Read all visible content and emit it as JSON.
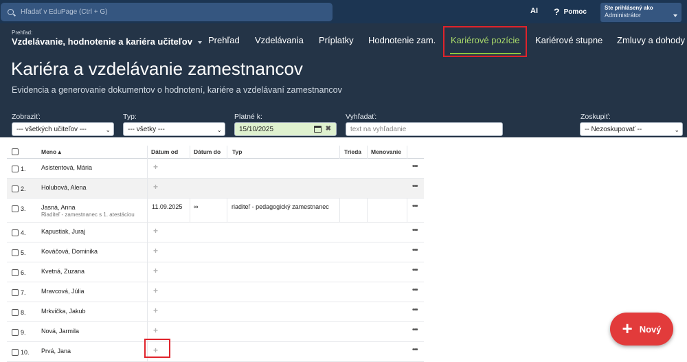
{
  "topbar": {
    "search_placeholder": "Hľadať v EduPage (Ctrl + G)",
    "ai_label": "AI",
    "help_label": "Pomoc",
    "user_label": "Ste prihlásený ako",
    "user_value": "Administrátor"
  },
  "header": {
    "breadcrumb_small": "Prehľad:",
    "breadcrumb_main": "Vzdelávanie, hodnotenie a kariéra učiteľov",
    "nav": [
      "Prehľad",
      "Vzdelávania",
      "Príplatky",
      "Hodnotenie zam.",
      "Kariérové pozície",
      "Kariérové stupne",
      "Zmluvy a dohody"
    ],
    "active_nav": "Kariérové pozície",
    "title": "Kariéra a vzdelávanie zamestnancov",
    "subtitle": "Evidencia a generovanie dokumentov o hodnotení, kariére a vzdelávaní zamestnancov"
  },
  "filters": {
    "show_label": "Zobraziť:",
    "show_value": "--- všetkých učiteľov ---",
    "type_label": "Typ:",
    "type_value": "--- všetky ---",
    "valid_label": "Platné k:",
    "valid_value": "15/10/2025",
    "search_label": "Vyhľadať:",
    "search_placeholder": "text na vyhľadanie",
    "group_label": "Zoskupiť:",
    "group_value": "-- Nezoskupovať --"
  },
  "table": {
    "columns": [
      "Meno",
      "Dátum od",
      "Dátum do",
      "Typ",
      "Trieda",
      "Menovanie"
    ],
    "rows": [
      {
        "num": "1.",
        "name": "Asistentová, Mária"
      },
      {
        "num": "2.",
        "name": "Holubová, Alena"
      },
      {
        "num": "3.",
        "name": "Jasná, Anna",
        "role": "Riaditeľ - zamestnanec s 1. atestáciou",
        "date_from": "11.09.2025",
        "date_to": "∞",
        "type": "riaditeľ - pedagogický zamestnanec"
      },
      {
        "num": "4.",
        "name": "Kapustiak, Juraj"
      },
      {
        "num": "5.",
        "name": "Kováčová, Dominika"
      },
      {
        "num": "6.",
        "name": "Kvetná, Zuzana"
      },
      {
        "num": "7.",
        "name": "Mravcová, Júlia"
      },
      {
        "num": "8.",
        "name": "Mrkvička, Jakub"
      },
      {
        "num": "9.",
        "name": "Nová, Jarmila"
      },
      {
        "num": "10.",
        "name": "Prvá, Jana"
      }
    ]
  },
  "fab": {
    "label": "Nový"
  },
  "colors": {
    "topbar": "#1c3552",
    "header": "#243447",
    "accent_green": "#8cc63f",
    "highlight_red": "#e0232b",
    "fab_red": "#e23b3b"
  }
}
